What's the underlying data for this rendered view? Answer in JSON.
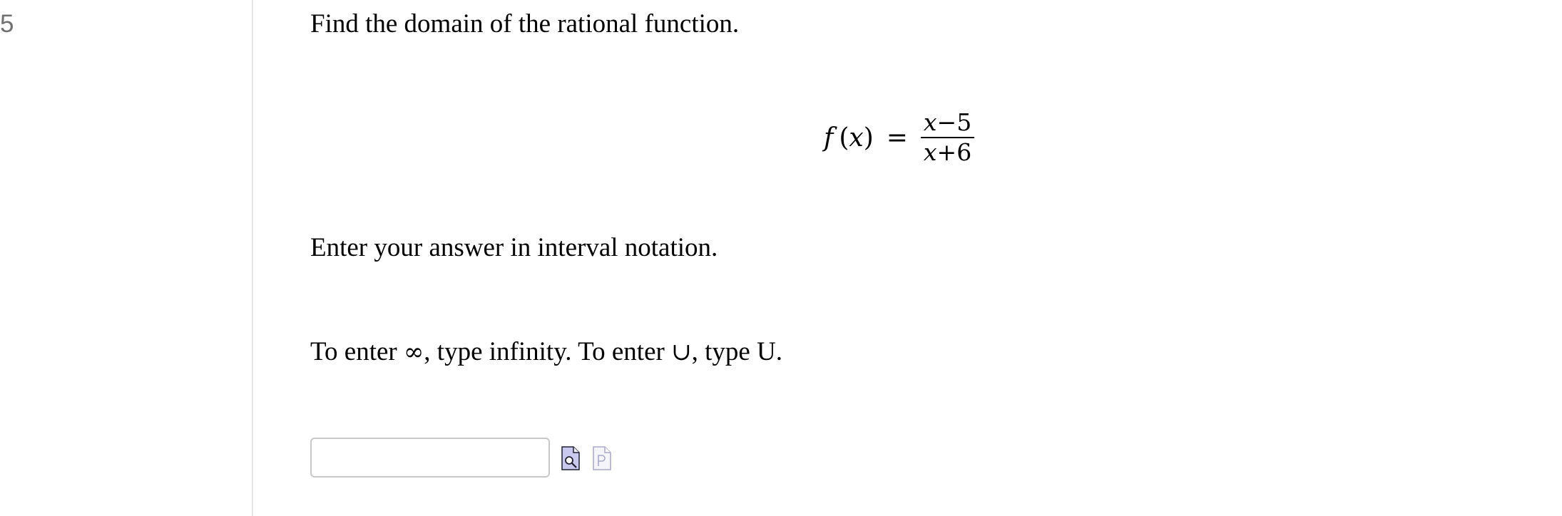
{
  "question": {
    "number": "5",
    "prompt": "Find the domain of the rational function.",
    "formula": {
      "fn": "f",
      "open_paren": "(",
      "var": "x",
      "close_paren": ")",
      "equals": "=",
      "numerator": {
        "var": "x",
        "op": "−",
        "const": "5"
      },
      "denominator": {
        "var": "x",
        "op": "+",
        "const": "6"
      }
    },
    "instruction": "Enter your answer in interval notation.",
    "hint": {
      "part1": "To enter ",
      "infinity_symbol": "∞",
      "part2": ", type infinity. To enter ",
      "union_symbol": "∪",
      "part3": ", type U."
    }
  },
  "answer": {
    "value": "",
    "placeholder": ""
  },
  "icons": {
    "preview": "preview-icon",
    "help": "help-icon"
  },
  "colors": {
    "question_number": "#707070",
    "divider": "#e6e6e6",
    "input_border": "#c8c8c8",
    "preview_icon_fill": "#c9c9f0",
    "help_icon_stroke": "#a8a8c8"
  }
}
